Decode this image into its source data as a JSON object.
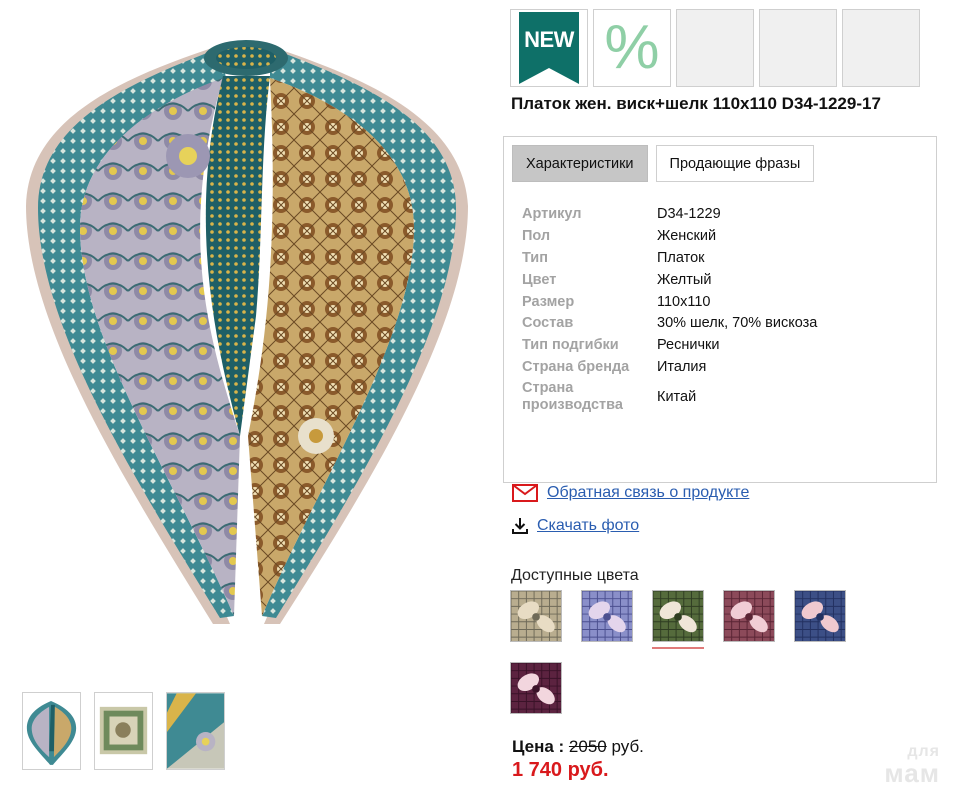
{
  "badges": {
    "new_label": "NEW",
    "sale_symbol": "%",
    "new_color": "#0e7068",
    "sale_color": "#8fcfa6"
  },
  "product": {
    "title": "Платок жен. виск+шелк 110х110 D34-1229-17"
  },
  "tabs": [
    {
      "label": "Характеристики",
      "active": true
    },
    {
      "label": "Продающие фразы",
      "active": false
    }
  ],
  "specs": [
    {
      "key": "Артикул",
      "value": "D34-1229"
    },
    {
      "key": "Пол",
      "value": "Женский"
    },
    {
      "key": "Тип",
      "value": "Платок"
    },
    {
      "key": "Цвет",
      "value": "Желтый"
    },
    {
      "key": "Размер",
      "value": "110х110"
    },
    {
      "key": "Состав",
      "value": "30% шелк, 70% вискоза"
    },
    {
      "key": "Тип подгибки",
      "value": "Реснички"
    },
    {
      "key": "Страна бренда",
      "value": "Италия"
    },
    {
      "key": "Страна производства",
      "value": "Китай"
    }
  ],
  "links": {
    "feedback": {
      "label": "Обратная связь о продукте",
      "icon": "envelope-icon",
      "icon_color": "#d9191c"
    },
    "download": {
      "label": "Скачать фото",
      "icon": "download-icon"
    }
  },
  "colors": {
    "label": "Доступные цвета",
    "selected_index": 2,
    "swatches": [
      {
        "name": "beige-gray",
        "base": "#b9ad8f",
        "accent": "#6f6a58",
        "flower": "#e8dcc4"
      },
      {
        "name": "lavender",
        "base": "#8a8fc9",
        "accent": "#4b4f8f",
        "flower": "#e4d5ec"
      },
      {
        "name": "olive-green",
        "base": "#556b3c",
        "accent": "#2f3d22",
        "flower": "#efe5d8"
      },
      {
        "name": "burgundy-pink",
        "base": "#8c4a5a",
        "accent": "#5a2535",
        "flower": "#f1cdd5"
      },
      {
        "name": "navy-rose",
        "base": "#3c4f86",
        "accent": "#233161",
        "flower": "#f0c9cf"
      },
      {
        "name": "plum",
        "base": "#5c2340",
        "accent": "#3a1228",
        "flower": "#f2d6de"
      }
    ]
  },
  "price": {
    "label": "Цена :",
    "old_value": "2050",
    "old_currency": "руб.",
    "new_value": "1 740 руб."
  },
  "watermark": {
    "line1": "для",
    "line2": "мам"
  }
}
